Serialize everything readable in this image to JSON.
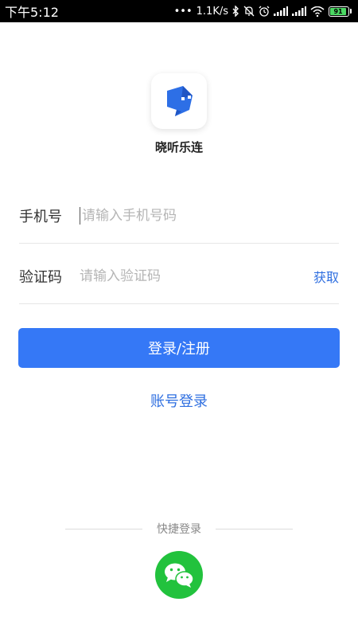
{
  "status_bar": {
    "time": "下午5:12",
    "dots": "•••",
    "network_speed": "1.1K/s",
    "battery_level": "91",
    "icons": [
      "bluetooth-icon",
      "mute-icon",
      "alarm-icon",
      "signal-icon",
      "signal-icon",
      "wifi-icon",
      "battery-icon"
    ]
  },
  "app": {
    "name": "晓听乐连",
    "logo_color": "#2d6fe6"
  },
  "form": {
    "phone_label": "手机号",
    "phone_placeholder": "请输入手机号码",
    "code_label": "验证码",
    "code_placeholder": "请输入验证码",
    "get_code_label": "获取"
  },
  "actions": {
    "login_label": "登录/注册",
    "account_login_label": "账号登录"
  },
  "quick_login": {
    "label": "快捷登录",
    "wechat_icon": "wechat-icon"
  },
  "colors": {
    "primary": "#3578f6",
    "link": "#2f6fe0",
    "wechat": "#22c23d"
  }
}
